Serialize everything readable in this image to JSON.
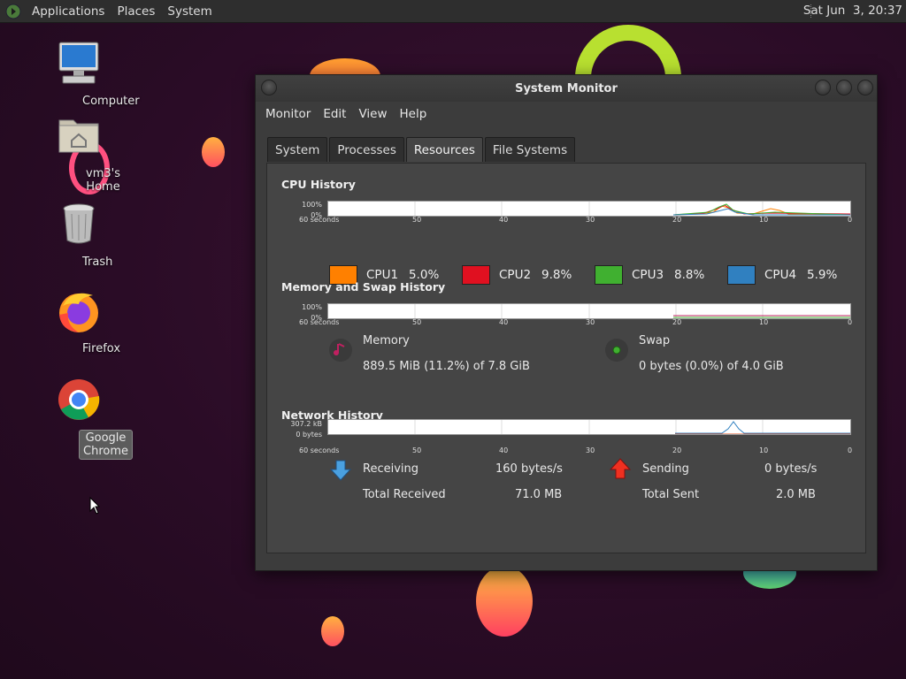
{
  "top_panel": {
    "menus": [
      "Applications",
      "Places",
      "System"
    ],
    "clock": "Sat Jun  3, 20:37"
  },
  "desktop": {
    "icons": [
      {
        "label": "Computer",
        "icon": "computer-icon"
      },
      {
        "label": "vm3's Home",
        "icon": "home-folder-icon"
      },
      {
        "label": "Trash",
        "icon": "trash-icon"
      },
      {
        "label": "Firefox",
        "icon": "firefox-icon"
      },
      {
        "label": "Google Chrome",
        "icon": "chrome-icon"
      }
    ]
  },
  "window": {
    "title": "System Monitor",
    "menu": [
      "Monitor",
      "Edit",
      "View",
      "Help"
    ],
    "tabs": [
      "System",
      "Processes",
      "Resources",
      "File Systems"
    ],
    "active_tab": "Resources"
  },
  "cpu": {
    "title": "CPU History",
    "y_top": "100%",
    "y_bottom": "0%",
    "cpus": [
      {
        "name": "CPU1",
        "value": "5.0%",
        "color": "#ff8000"
      },
      {
        "name": "CPU2",
        "value": "9.8%",
        "color": "#e01020"
      },
      {
        "name": "CPU3",
        "value": "8.8%",
        "color": "#40b030"
      },
      {
        "name": "CPU4",
        "value": "5.9%",
        "color": "#3080c0"
      }
    ]
  },
  "memory": {
    "title": "Memory and Swap History",
    "y_top": "100%",
    "y_bottom": "0%",
    "memory_label": "Memory",
    "memory_value": "889.5 MiB (11.2%) of 7.8 GiB",
    "swap_label": "Swap",
    "swap_value": "0 bytes (0.0%) of 4.0 GiB",
    "memory_color": "#c02060",
    "swap_color": "#40b030"
  },
  "network": {
    "title": "Network History",
    "y_top": "307.2 kB",
    "y_bottom": "0 bytes",
    "receiving_label": "Receiving",
    "receiving_value": "160 bytes/s",
    "total_received_label": "Total Received",
    "total_received_value": "71.0 MB",
    "sending_label": "Sending",
    "sending_value": "0 bytes/s",
    "total_sent_label": "Total Sent",
    "total_sent_value": "2.0 MB"
  },
  "x_axis": [
    "60 seconds",
    "50",
    "40",
    "30",
    "20",
    "10",
    "0"
  ]
}
